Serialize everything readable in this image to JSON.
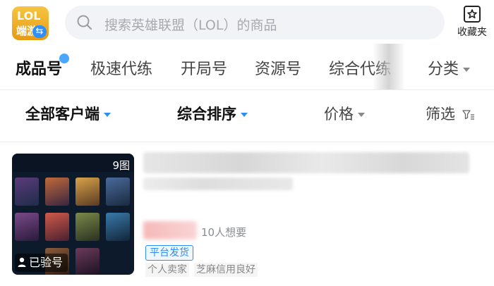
{
  "header": {
    "logo": {
      "line1": "LOL",
      "line2": "端游",
      "swap_glyph": "⇆"
    },
    "search": {
      "placeholder": "搜索英雄联盟（LOL）的商品",
      "icon": "search-icon"
    },
    "favorites": {
      "label": "收藏夹",
      "icon": "star-box-icon"
    }
  },
  "tabs": [
    {
      "label": "成品号",
      "active": true
    },
    {
      "label": "极速代练"
    },
    {
      "label": "开局号"
    },
    {
      "label": "资源号"
    },
    {
      "label": "综合代练"
    },
    {
      "label": "分类"
    }
  ],
  "filters": {
    "client": "全部客户端",
    "sort": "综合排序",
    "price": "价格",
    "screen": "筛选"
  },
  "product": {
    "image_count": "9图",
    "verified": "已验号",
    "want_count": "10人想要",
    "badge": "平台发货",
    "tags": [
      "个人卖家",
      "芝麻信用良好"
    ]
  },
  "colors": {
    "accent": "#2d8df6",
    "logo_gold": "#e79b14",
    "search_bg": "#f2f3f6"
  }
}
